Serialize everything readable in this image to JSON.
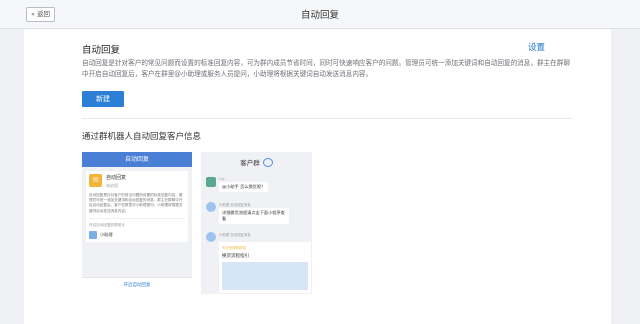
{
  "topbar": {
    "back_label": "返回",
    "title": "自动回复"
  },
  "main": {
    "section_title": "自动回复",
    "settings_label": "设置",
    "description": "自动回复是针对客户的常见问题而设置的标准回复内容，可为群内成员节省时间，同时可快速响应客户的问题。管理员可统一添加关键词和自动回复的消息，群主在群聊中开启自动回复后，客户在群里@小助理或服务人员提问，小助理将根据关键词自动发送消息内容。",
    "new_button": "新建",
    "sub_title": "通过群机器人自动回复客户信息"
  },
  "preview_left": {
    "header": "自动回复",
    "item_name": "自动回复",
    "item_status": "未启用",
    "item_desc": "自动回复是针对客户的常见问题而设置的标准回复内容，管理员可统一添加关键词和自动回复的消息，群主在群聊中开启自动回复后，客户在群里@小助理提问，小助理将根据关键词自动发送消息内容。",
    "enabled_label": "开启自动回复的群助手",
    "member_name": "小助理",
    "footer_button": "开启自动回复"
  },
  "preview_right": {
    "header": "客户群",
    "messages": [
      {
        "name": "Lily",
        "text": "@小助手 怎么换货呢？"
      },
      {
        "name": "小助理 自动回复消息",
        "text": "详细换货流程请点击下面小程序查看"
      },
      {
        "name": "小助理 自动回复消息",
        "text": ""
      }
    ],
    "card_line": "天天全球购精选",
    "card_title": "换货流程指引"
  },
  "colors": {
    "accent": "#2b7fd6",
    "link": "#1a73c9",
    "header_blue": "#4a7fd6"
  }
}
